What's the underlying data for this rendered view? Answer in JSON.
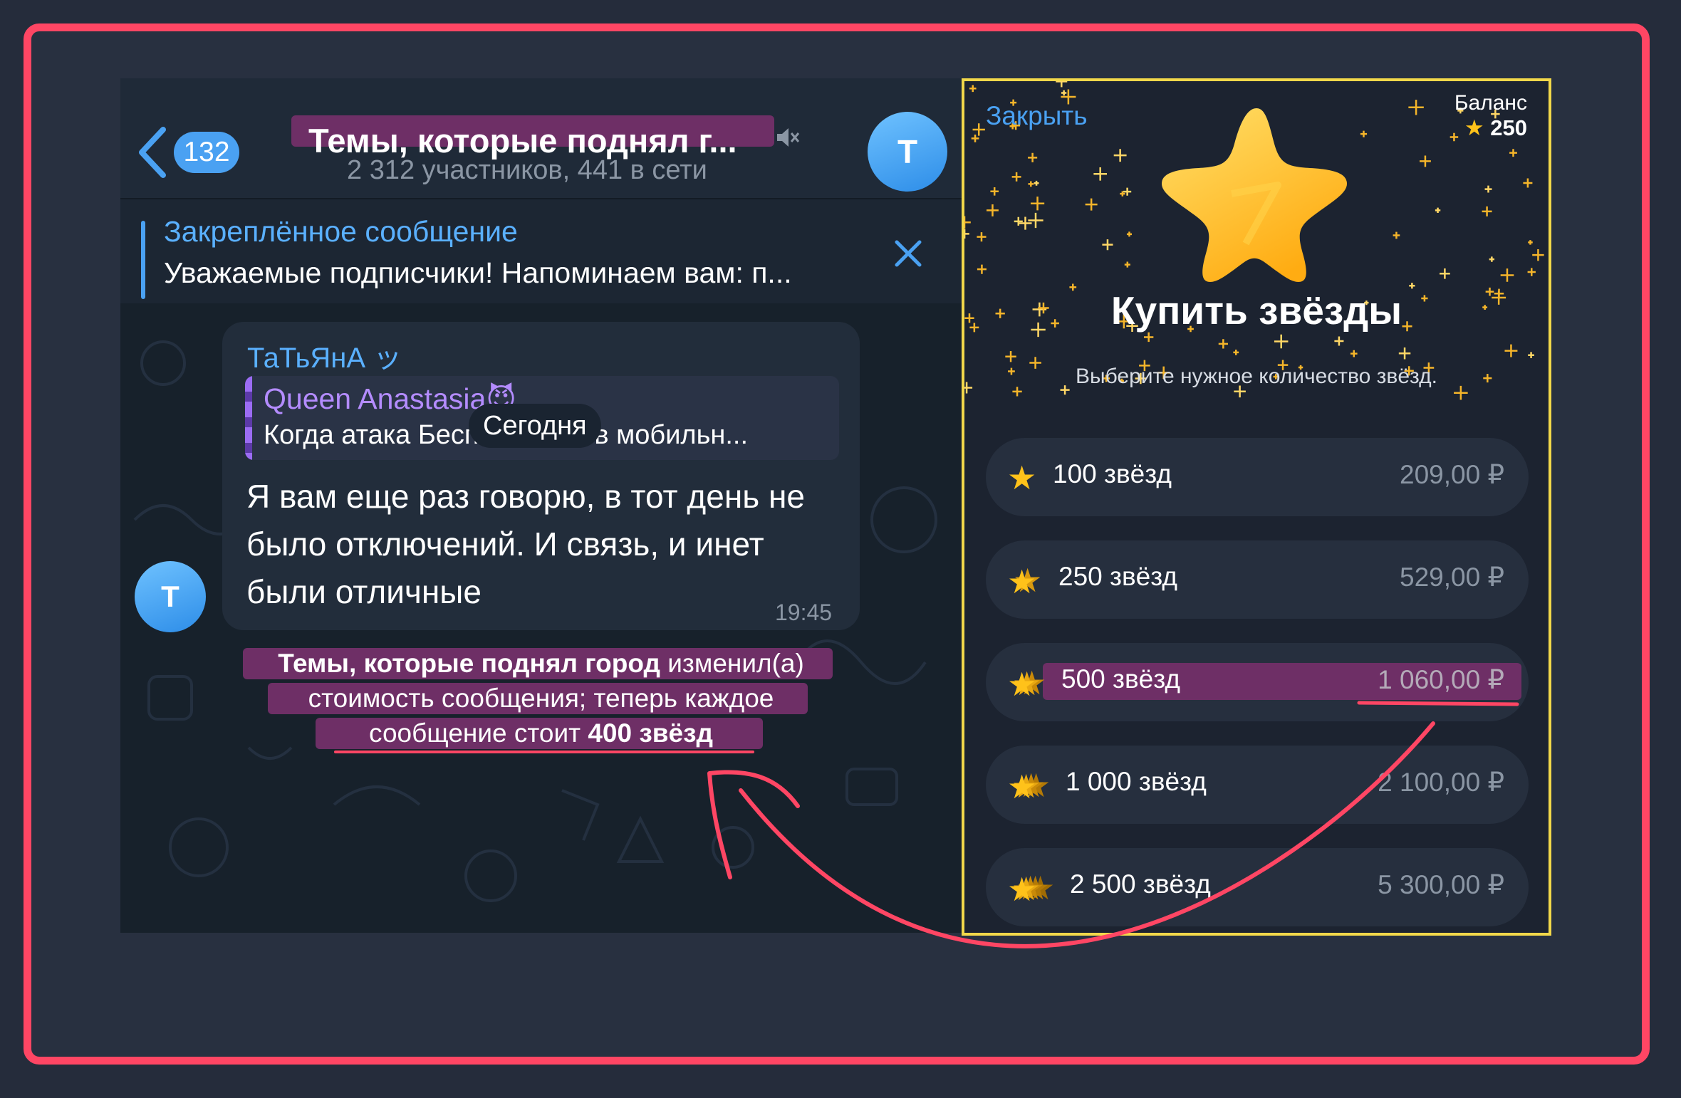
{
  "chat": {
    "back_badge": "132",
    "title": "Темы, которые поднял г...",
    "subtitle": "2 312 участников, 441 в сети",
    "avatar_letter": "T",
    "pinned": {
      "title": "Закреплённое сообщение",
      "text": "Уважаемые подписчики! Напоминаем вам: п..."
    },
    "message": {
      "sender": "ТаТьЯнА ッ",
      "date_chip": "Сегодня",
      "reply_name": "Queen Anastasia😈",
      "reply_text": "Когда атака Беспилотников мобильн...",
      "text": "Я вам еще раз говорю, в тот день не было отключений. И связь, и инет были отличные",
      "time": "19:45",
      "avatar_letter": "T"
    },
    "service": {
      "line1_bold": "Темы, которые поднял город",
      "line1_rest": " изменил(а)",
      "line2": "стоимость сообщения; теперь каждое",
      "line3_start": "сообщение стоит ",
      "line3_bold": "400 звёзд"
    }
  },
  "stars": {
    "close_label": "Закрыть",
    "balance_label": "Баланс",
    "balance_value": "250",
    "title": "Купить звёзды",
    "subtitle": "Выберите нужное количество звёзд.",
    "options": [
      {
        "label": "100 звёзд",
        "price": "209,00 ₽"
      },
      {
        "label": "250 звёзд",
        "price": "529,00 ₽"
      },
      {
        "label": "500 звёзд",
        "price": "1 060,00 ₽"
      },
      {
        "label": "1 000 звёзд",
        "price": "2 100,00 ₽"
      },
      {
        "label": "2 500 звёзд",
        "price": "5 300,00 ₽"
      }
    ]
  },
  "colors": {
    "frame": "#ff4664",
    "highlight": "#6e2f66",
    "accent_blue": "#4aa1f2",
    "panel_border": "#f2d84a",
    "star": "#ffc21a"
  }
}
